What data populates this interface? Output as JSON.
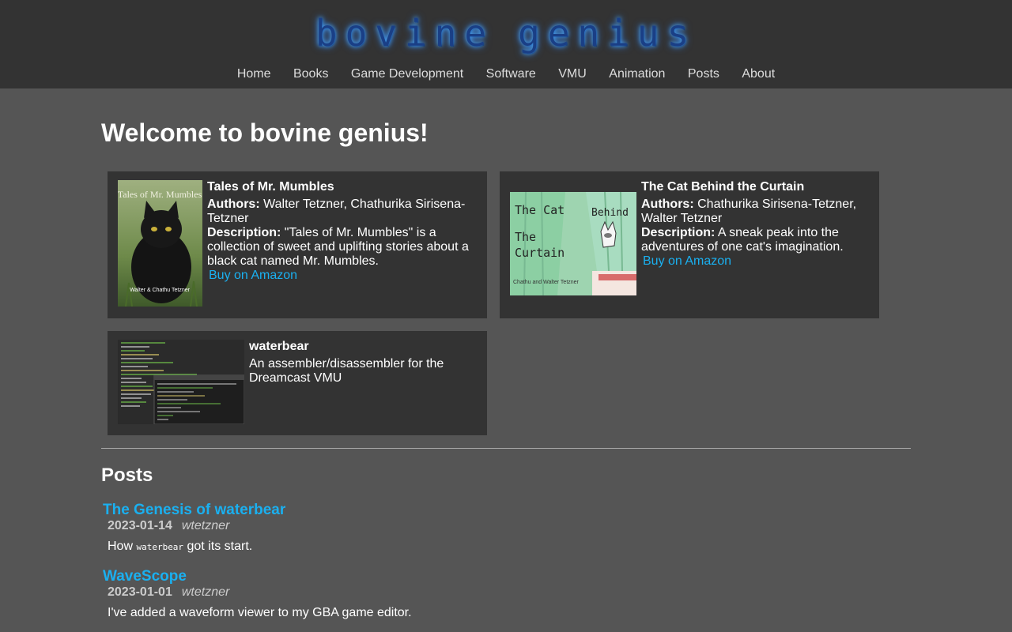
{
  "site": {
    "logo_text_1": "bovine",
    "logo_text_2": "genius"
  },
  "nav": [
    "Home",
    "Books",
    "Game Development",
    "Software",
    "VMU",
    "Animation",
    "Posts",
    "About"
  ],
  "page_title": "Welcome to bovine genius!",
  "books": [
    {
      "title": "Tales of Mr. Mumbles",
      "authors_label": "Authors:",
      "authors": "Walter Tetzner, Chathurika Sirisena-Tetzner",
      "description_label": "Description:",
      "description": "\"Tales of Mr. Mumbles\" is a collection of sweet and uplifting stories about a black cat named Mr. Mumbles.",
      "link": "Buy on Amazon",
      "cover_text_top": "Tales of Mr. Mumbles",
      "cover_text_bottom": "Walter & Chathu Tetzner"
    },
    {
      "title": "The Cat Behind the Curtain",
      "authors_label": "Authors:",
      "authors": "Chathurika Sirisena-Tetzner, Walter Tetzner",
      "description_label": "Description:",
      "description": "A sneak peak into the adventures of one cat's imagination.",
      "link": "Buy on Amazon",
      "cover_text_1": "The Cat",
      "cover_text_2": "Behind",
      "cover_text_3": "The",
      "cover_text_4": "Curtain",
      "cover_text_bottom": "Chathu and Walter Tetzner"
    }
  ],
  "software": [
    {
      "title": "waterbear",
      "description": "An assembler/disassembler for the Dreamcast VMU"
    }
  ],
  "posts_heading": "Posts",
  "posts": [
    {
      "title": "The Genesis of waterbear",
      "date": "2023-01-14",
      "author": "wtetzner",
      "summary_pre": "How ",
      "summary_code": "waterbear",
      "summary_post": " got its start."
    },
    {
      "title": "WaveScope",
      "date": "2023-01-01",
      "author": "wtetzner",
      "summary": "I've added a waveform viewer to my GBA game editor."
    }
  ],
  "colors": {
    "header_bg": "#333333",
    "page_bg": "#555555",
    "card_bg": "#333333",
    "link": "#1ab0f0"
  }
}
